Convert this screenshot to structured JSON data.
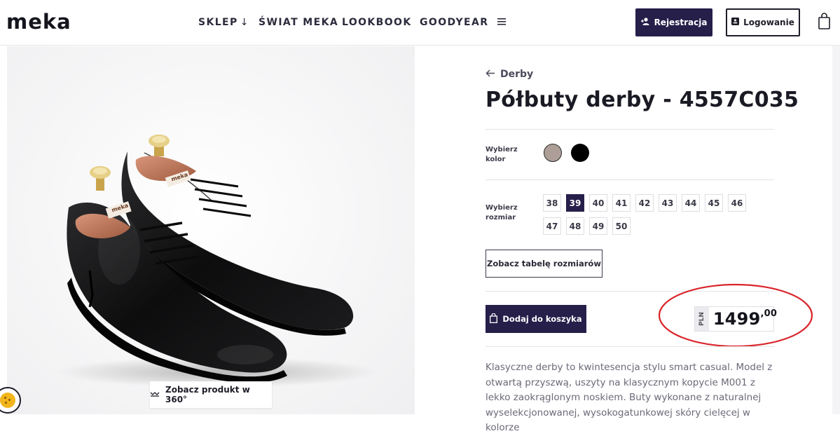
{
  "header": {
    "logo": "meka",
    "nav": [
      {
        "label": "SKLEP",
        "suffix": "↓"
      },
      {
        "label": "ŚWIAT MEKA"
      },
      {
        "label": "LOOKBOOK"
      },
      {
        "label": "GOODYEAR"
      }
    ],
    "menu_icon": "hamburger-icon",
    "register_label": "Rejestracja",
    "login_label": "Logowanie",
    "cart_icon": "shopping-bag-icon"
  },
  "product": {
    "back_label": "Derby",
    "title": "Półbuty derby - 4557C035",
    "color_label": "Wybierz kolor",
    "colors": [
      "#ad9f98",
      "#000000"
    ],
    "size_label": "Wybierz rozmiar",
    "sizes": [
      "38",
      "39",
      "40",
      "41",
      "42",
      "43",
      "44",
      "45",
      "46",
      "47",
      "48",
      "49",
      "50"
    ],
    "selected_size": "39",
    "size_table_label": "Zobacz tabelę rozmiarów",
    "add_to_cart_label": "Dodaj do koszyka",
    "currency": "PLN",
    "price_main": "1499",
    "price_decimal": ",00",
    "description": "Klasyczne derby to kwintesencja stylu smart casual. Model z otwartą przyszwą, uszyty na klasycznym kopycie M001 z lekko zaokrąglonym noskiem. Buty wykonane z naturalnej wyselekcjonowanej, wysokogatunkowej skóry cielęcej w kolorze",
    "view_360_label": "Zobacz produkt w 360°",
    "shoe_tree_brand": "meka"
  },
  "colors": {
    "accent": "#251f4a",
    "annotation": "#d9262b"
  }
}
